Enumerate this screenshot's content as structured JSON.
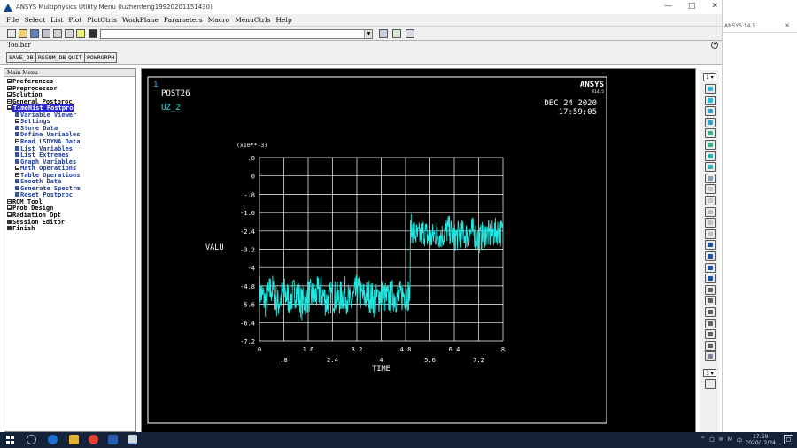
{
  "window": {
    "title": "ANSYS Multiphysics Utility Menu (luzhenfeng19920201151430)"
  },
  "menubar": [
    "File",
    "Select",
    "List",
    "Plot",
    "PlotCtrls",
    "WorkPlane",
    "Parameters",
    "Macro",
    "MenuCtrls",
    "Help"
  ],
  "toolbar": {
    "label": "Toolbar",
    "command_value": "",
    "buttons": [
      "SAVE_DB",
      "RESUM_DB",
      "QUIT",
      "POWRGRPH"
    ]
  },
  "main_menu": {
    "header": "Main Menu",
    "items": [
      {
        "label": "Preferences",
        "level": 0,
        "kind": "exp"
      },
      {
        "label": "Preprocessor",
        "level": 0,
        "kind": "exp"
      },
      {
        "label": "Solution",
        "level": 0,
        "kind": "exp"
      },
      {
        "label": "General Postproc",
        "level": 0,
        "kind": "exp"
      },
      {
        "label": "TimeHist Postpro",
        "level": 0,
        "kind": "sel"
      },
      {
        "label": "Variable Viewer",
        "level": 1,
        "kind": "sq"
      },
      {
        "label": "Settings",
        "level": 1,
        "kind": "exp"
      },
      {
        "label": "Store Data",
        "level": 1,
        "kind": "sq"
      },
      {
        "label": "Define Variables",
        "level": 1,
        "kind": "sq"
      },
      {
        "label": "Read LSDYNA Data",
        "level": 1,
        "kind": "exp"
      },
      {
        "label": "List Variables",
        "level": 1,
        "kind": "sq"
      },
      {
        "label": "List Extremes",
        "level": 1,
        "kind": "sq"
      },
      {
        "label": "Graph Variables",
        "level": 1,
        "kind": "sq"
      },
      {
        "label": "Math Operations",
        "level": 1,
        "kind": "exp"
      },
      {
        "label": "Table Operations",
        "level": 1,
        "kind": "exp"
      },
      {
        "label": "Smooth Data",
        "level": 1,
        "kind": "sq"
      },
      {
        "label": "Generate Spectrm",
        "level": 1,
        "kind": "sq"
      },
      {
        "label": "Reset Postproc",
        "level": 1,
        "kind": "sq"
      },
      {
        "label": "ROM Tool",
        "level": 0,
        "kind": "exp"
      },
      {
        "label": "Prob Design",
        "level": 0,
        "kind": "exp"
      },
      {
        "label": "Radiation Opt",
        "level": 0,
        "kind": "exp"
      },
      {
        "label": "Session Editor",
        "level": 0,
        "kind": "sq"
      },
      {
        "label": "Finish",
        "level": 0,
        "kind": "sq"
      }
    ]
  },
  "graphics": {
    "window_number": "1",
    "logo": "ANSYS",
    "version": "R14.5",
    "post_label": "POST26",
    "variable_label": "UZ_2",
    "date": "DEC 24 2020",
    "time": "17:59:05",
    "colors": {
      "background": "#000000",
      "curve": "#1fe8e0",
      "grid": "#ffffff",
      "text": "#ffffff",
      "window_number": "#20c0ff"
    }
  },
  "chart_data": {
    "type": "line",
    "xlabel": "TIME",
    "ylabel": "VALU",
    "y_multiplier": "(x10**-3)",
    "xlim": [
      0,
      8
    ],
    "ylim": [
      -7.2,
      0.8
    ],
    "x_ticks_bottom": [
      "0",
      "1.6",
      "3.2",
      "4.8",
      "6.4",
      "8"
    ],
    "x_ticks_top": [
      ".8",
      "2.4",
      "4",
      "5.6",
      "7.2"
    ],
    "y_ticks": [
      ".8",
      "0",
      "-.8",
      "-1.6",
      "-2.4",
      "-3.2",
      "-4",
      "-4.8",
      "-5.6",
      "-6.4",
      "-7.2"
    ],
    "series": [
      {
        "values_description_step_time": 4.95,
        "x": [
          0.0,
          0.2,
          0.4,
          0.6,
          0.8,
          1.0,
          1.2,
          1.4,
          1.6,
          1.8,
          2.0,
          2.2,
          2.4,
          2.6,
          2.8,
          3.0,
          3.2,
          3.4,
          3.6,
          3.8,
          4.0,
          4.2,
          4.4,
          4.6,
          4.8,
          4.95,
          5.0,
          5.2,
          5.4,
          5.6,
          5.8,
          6.0,
          6.2,
          6.4,
          6.6,
          6.8,
          7.0,
          7.2,
          7.4,
          7.6,
          7.8,
          8.0
        ],
        "y": [
          -5.0,
          -5.5,
          -4.9,
          -5.6,
          -5.1,
          -5.4,
          -5.0,
          -5.6,
          -5.2,
          -5.3,
          -5.0,
          -5.5,
          -5.2,
          -5.4,
          -5.1,
          -5.6,
          -5.0,
          -5.3,
          -5.2,
          -5.5,
          -5.1,
          -5.4,
          -5.2,
          -5.3,
          -5.1,
          -5.2,
          -2.3,
          -2.7,
          -2.4,
          -2.8,
          -2.5,
          -2.6,
          -2.3,
          -2.7,
          -2.5,
          -2.6,
          -2.4,
          -2.8,
          -2.5,
          -2.6,
          -2.4,
          -2.5
        ]
      }
    ],
    "noise_amplitude": 0.75,
    "curve_color": "#1fe8e0"
  },
  "taskbar": {
    "time": "17:59",
    "date": "2020/12/24",
    "tray": [
      "^",
      "□",
      "✉",
      "M",
      "中"
    ]
  },
  "bg_window": {
    "tab_text": "ANSYS 14.5"
  }
}
